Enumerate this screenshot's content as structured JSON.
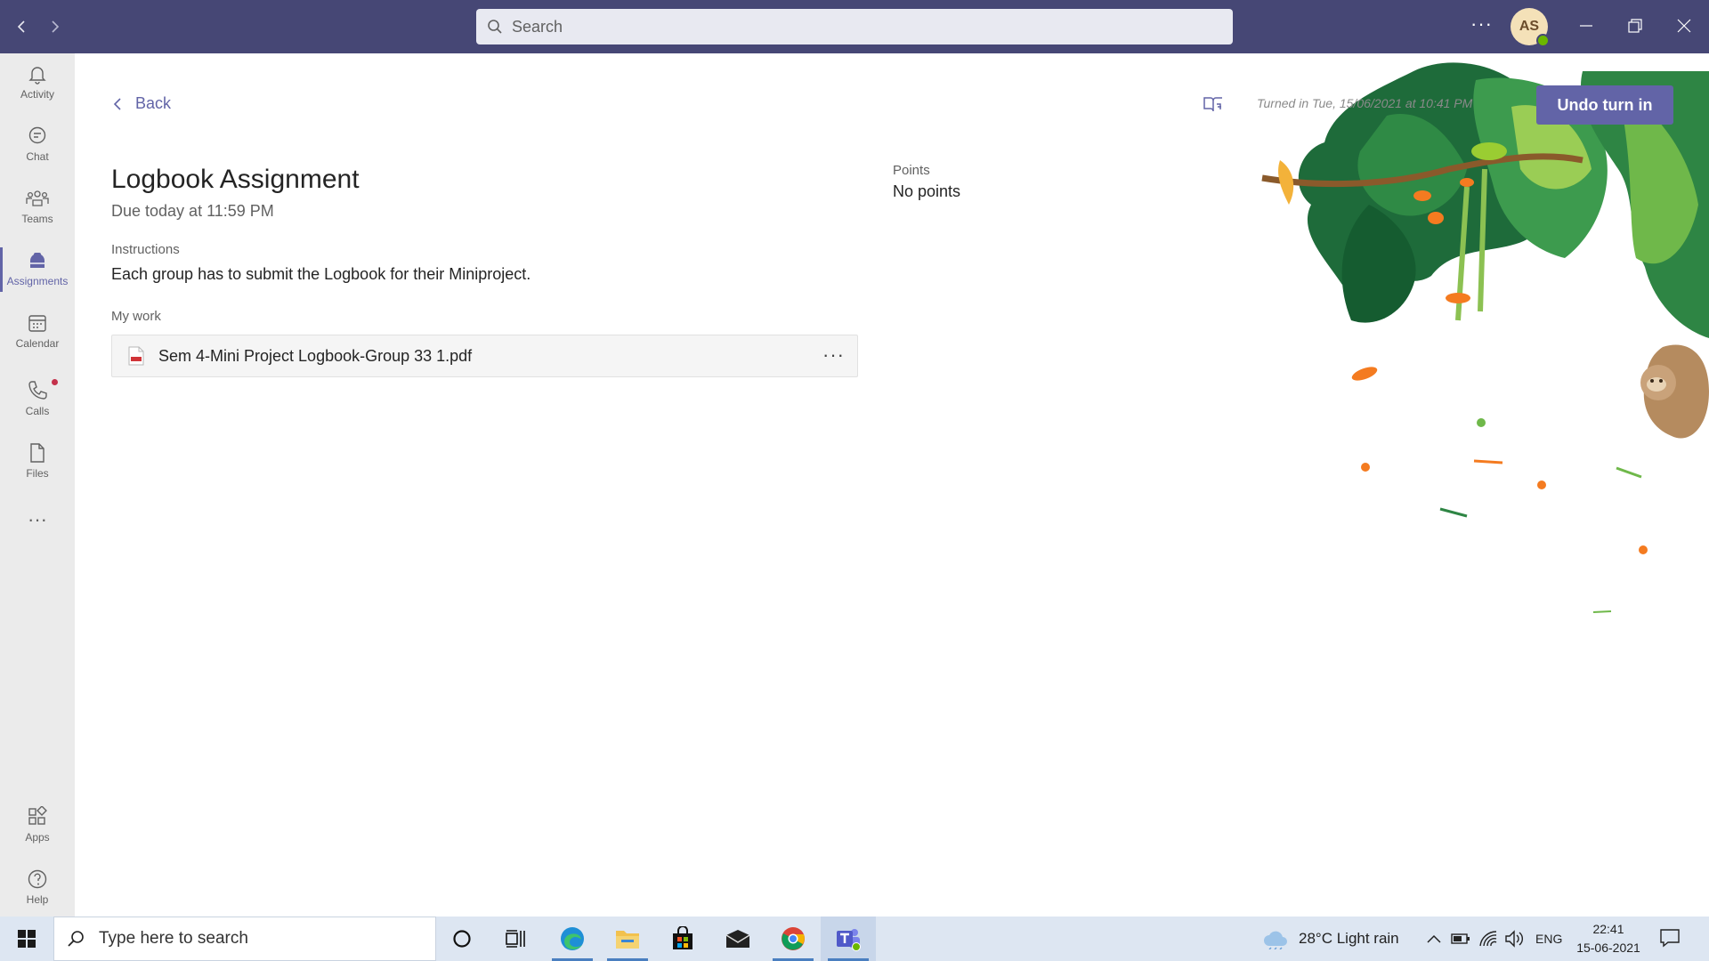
{
  "titlebar": {
    "search_placeholder": "Search",
    "avatar_initials": "AS",
    "more_label": "···"
  },
  "rail": {
    "items": [
      {
        "label": "Activity",
        "icon": "bell-icon"
      },
      {
        "label": "Chat",
        "icon": "chat-icon"
      },
      {
        "label": "Teams",
        "icon": "teams-icon"
      },
      {
        "label": "Assignments",
        "icon": "assignments-icon"
      },
      {
        "label": "Calendar",
        "icon": "calendar-icon"
      },
      {
        "label": "Calls",
        "icon": "phone-icon"
      },
      {
        "label": "Files",
        "icon": "file-icon"
      }
    ],
    "more_label": "···",
    "bottom": [
      {
        "label": "Apps",
        "icon": "apps-icon"
      },
      {
        "label": "Help",
        "icon": "help-icon"
      }
    ],
    "active": "Assignments"
  },
  "assignment": {
    "back_label": "Back",
    "title": "Logbook Assignment",
    "due": "Due today at 11:59 PM",
    "instructions_label": "Instructions",
    "instructions_text": "Each group has to submit the Logbook for their Miniproject.",
    "my_work_label": "My work",
    "file_name": "Sem 4-Mini Project Logbook-Group 33 1.pdf",
    "file_more": "···",
    "points_label": "Points",
    "points_value": "No points",
    "turned_in_text": "Turned in Tue, 15/06/2021 at 10:41 PM",
    "undo_label": "Undo turn in"
  },
  "taskbar": {
    "search_placeholder": "Type here to search",
    "weather": "28°C  Light rain",
    "language": "ENG",
    "time": "22:41",
    "date": "15-06-2021"
  },
  "colors": {
    "titlebar": "#464775",
    "accent": "#6264a7",
    "rail": "#ebebeb"
  }
}
